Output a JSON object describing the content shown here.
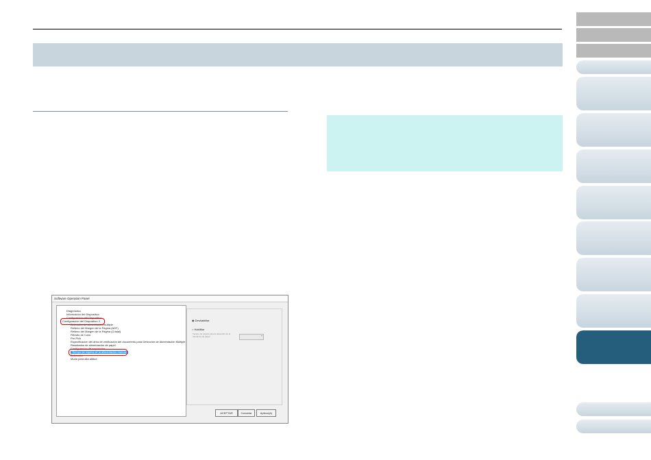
{
  "dialog": {
    "title": "Software Operation Panel",
    "tree_items": [
      "Diagnóstico",
      "Información del Dispositivo",
      "Configuración del Dispositivo",
      "Configuración del Dispositivo 2",
      "Detección de alimentación múltiple",
      "Relleno del Margen de la Página (ADF)",
      "Relleno del Margen de la Página (Cristal)",
      "Filtrado de Color",
      "Pre-Pick",
      "Especificación del área de verificación del documento para Detección de Alimentación Múltiple",
      "Resultados de alimentación de papel",
      "Configuración de exposición",
      "Tiempo de espera de la alimentación manual",
      "Detección",
      "Modo para alta altitud"
    ],
    "options": {
      "disable": "Deshabilitar",
      "enable": "Habilitar",
      "timeout_label": "Tiempo de espera para la detección de la tolerancia de papel:"
    },
    "buttons": {
      "ok": "ACEPTAR",
      "cancel": "Cancelar",
      "apply": "Aplicar(A)"
    }
  }
}
